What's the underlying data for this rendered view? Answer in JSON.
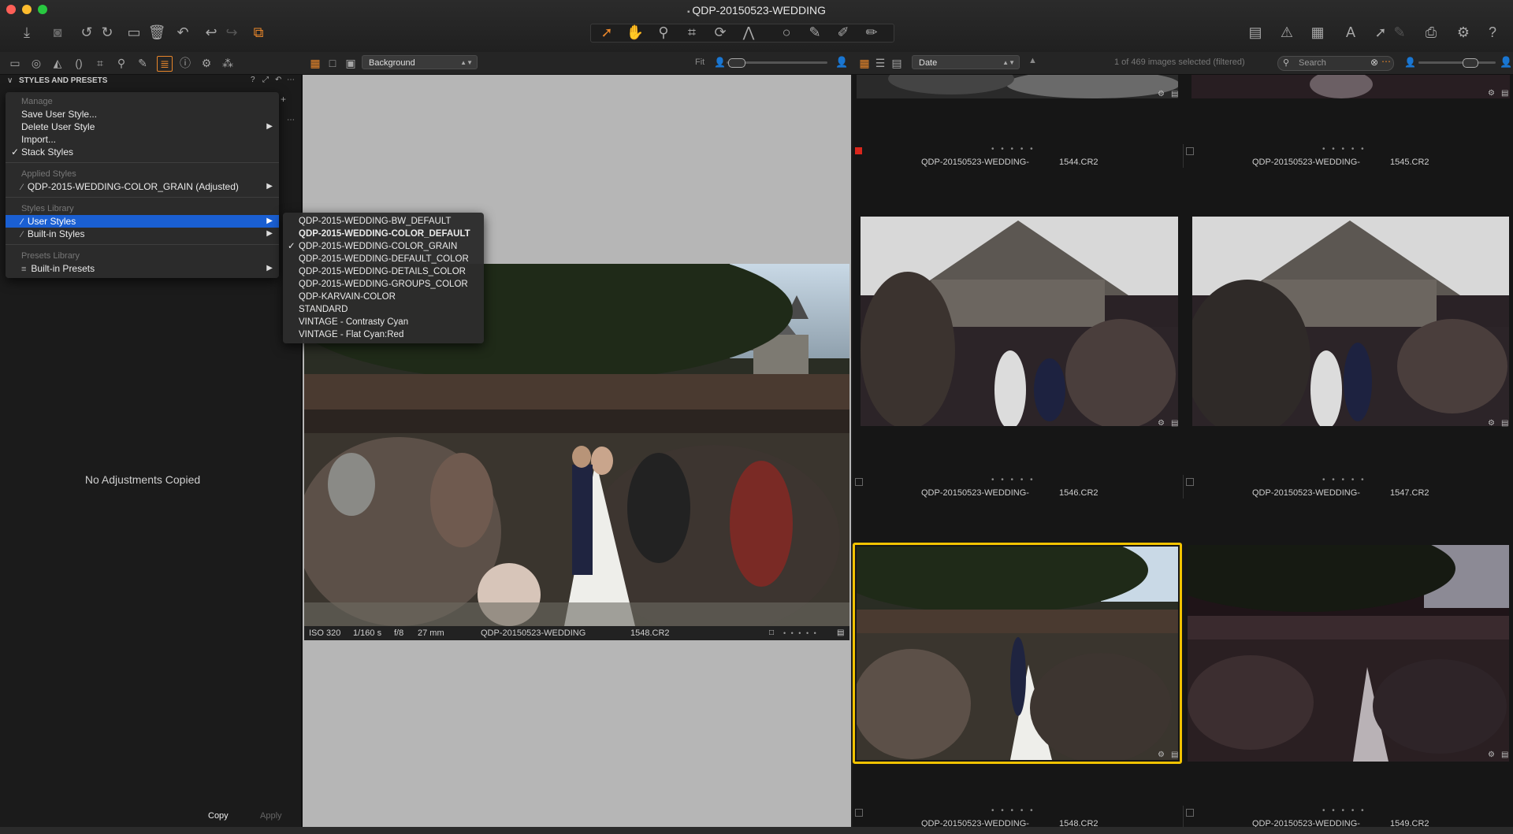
{
  "window": {
    "title": "QDP-20150523-WEDDING"
  },
  "toolbar_row2": {
    "viewer_bg_select": "Background",
    "fit_label": "Fit",
    "sort_select": "Date",
    "selection_status": "1 of 469 images selected (filtered)",
    "search_placeholder": "Search"
  },
  "left_panel": {
    "title": "STYLES AND PRESETS",
    "empty_message": "No Adjustments Copied",
    "copy_label": "Copy",
    "apply_label": "Apply"
  },
  "menu": {
    "manage_header": "Manage",
    "save_user_style": "Save User Style...",
    "delete_user_style": "Delete User Style",
    "import": "Import...",
    "stack_styles": "Stack Styles",
    "applied_header": "Applied Styles",
    "applied_item": "QDP-2015-WEDDING-COLOR_GRAIN (Adjusted)",
    "library_header": "Styles Library",
    "user_styles": "User Styles",
    "builtin_styles": "Built-in Styles",
    "presets_header": "Presets Library",
    "builtin_presets": "Built-in Presets"
  },
  "submenu": {
    "items": [
      "QDP-2015-WEDDING-BW_DEFAULT",
      "QDP-2015-WEDDING-COLOR_DEFAULT",
      "QDP-2015-WEDDING-COLOR_GRAIN",
      "QDP-2015-WEDDING-DEFAULT_COLOR",
      "QDP-2015-WEDDING-DETAILS_COLOR",
      "QDP-2015-WEDDING-GROUPS_COLOR",
      "QDP-KARVAIN-COLOR",
      "STANDARD",
      "VINTAGE - Contrasty Cyan",
      "VINTAGE - Flat Cyan:Red"
    ],
    "checked_index": 2,
    "bold_index": 1
  },
  "viewer": {
    "iso": "ISO 320",
    "shutter": "1/160 s",
    "aperture": "f/8",
    "focal": "27 mm",
    "name_prefix": "QDP-20150523-WEDDING",
    "name_suffix": "1548.CR2",
    "rating_dots": "• • • • •"
  },
  "thumbnails": [
    {
      "prefix": "QDP-20150523-WEDDING-",
      "suffix": "1544.CR2",
      "dots": "• • • • •"
    },
    {
      "prefix": "QDP-20150523-WEDDING-",
      "suffix": "1545.CR2",
      "dots": "• • • • •"
    },
    {
      "prefix": "QDP-20150523-WEDDING-",
      "suffix": "1546.CR2",
      "dots": "• • • • •"
    },
    {
      "prefix": "QDP-20150523-WEDDING-",
      "suffix": "1547.CR2",
      "dots": "• • • • •"
    },
    {
      "prefix": "QDP-20150523-WEDDING-",
      "suffix": "1548.CR2",
      "dots": "• • • • •"
    },
    {
      "prefix": "QDP-20150523-WEDDING-",
      "suffix": "1549.CR2",
      "dots": "• • • • •"
    }
  ],
  "colors": {
    "accent_orange": "#e8862a",
    "selection_blue": "#1a5fd2",
    "selected_thumb_border": "#f2c300",
    "red_tag": "#d9261c"
  }
}
